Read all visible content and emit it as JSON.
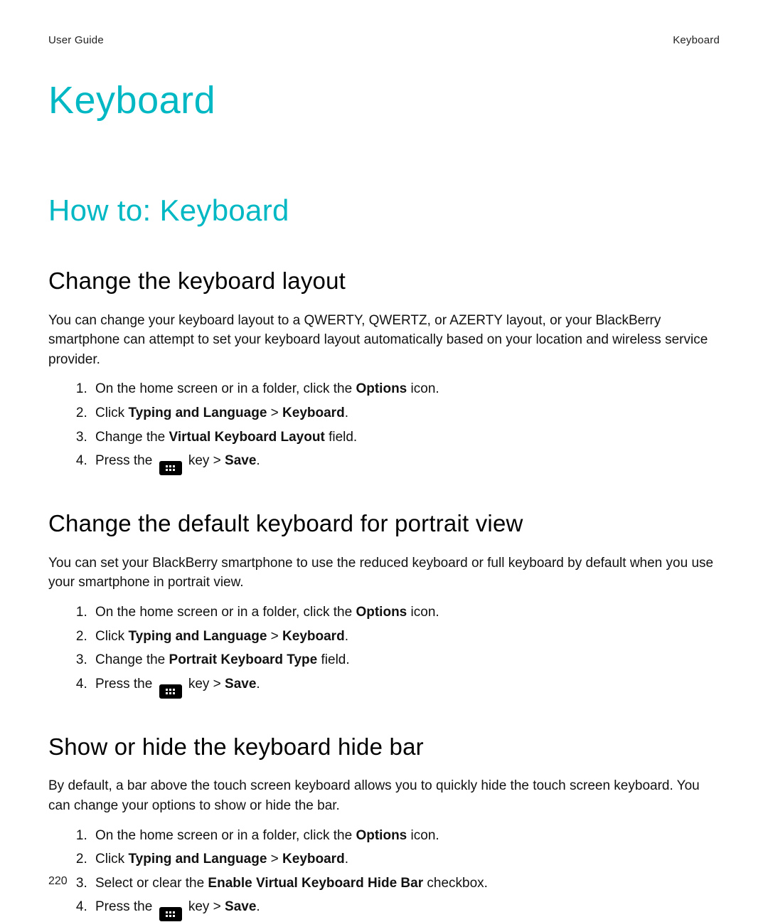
{
  "runhead": {
    "left": "User Guide",
    "right": "Keyboard"
  },
  "chapter_title": "Keyboard",
  "section_title": "How to: Keyboard",
  "groups": [
    {
      "heading": "Change the keyboard layout",
      "intro": "You can change your keyboard layout to a QWERTY, QWERTZ, or AZERTY layout, or your BlackBerry smartphone can attempt to set your keyboard layout automatically based on your location and wireless service provider.",
      "steps": [
        {
          "type": "textbold",
          "pre": "On the home screen or in a folder, click the ",
          "bold": "Options",
          "post": " icon."
        },
        {
          "type": "path",
          "prefix": "Click ",
          "a": "Typing and Language",
          "sep": " > ",
          "b": "Keyboard",
          "suffix": "."
        },
        {
          "type": "textbold",
          "pre": "Change the ",
          "bold": "Virtual Keyboard Layout",
          "post": " field."
        },
        {
          "type": "press_save",
          "pre": "Press the ",
          "mid": " key > ",
          "bold": "Save",
          "post": "."
        }
      ]
    },
    {
      "heading": "Change the default keyboard for portrait view",
      "intro": "You can set your BlackBerry smartphone to use the reduced keyboard or full keyboard by default when you use your smartphone in portrait view.",
      "steps": [
        {
          "type": "textbold",
          "pre": "On the home screen or in a folder, click the ",
          "bold": "Options",
          "post": " icon."
        },
        {
          "type": "path",
          "prefix": "Click ",
          "a": "Typing and Language",
          "sep": " > ",
          "b": "Keyboard",
          "suffix": "."
        },
        {
          "type": "textbold",
          "pre": "Change the ",
          "bold": "Portrait Keyboard Type",
          "post": " field."
        },
        {
          "type": "press_save",
          "pre": "Press the ",
          "mid": " key > ",
          "bold": "Save",
          "post": "."
        }
      ]
    },
    {
      "heading": "Show or hide the keyboard hide bar",
      "intro": "By default, a bar above the touch screen keyboard allows you to quickly hide the touch screen keyboard. You can change your options to show or hide the bar.",
      "steps": [
        {
          "type": "textbold",
          "pre": "On the home screen or in a folder, click the ",
          "bold": "Options",
          "post": " icon."
        },
        {
          "type": "path",
          "prefix": "Click ",
          "a": "Typing and Language",
          "sep": " > ",
          "b": "Keyboard",
          "suffix": "."
        },
        {
          "type": "textbold",
          "pre": "Select or clear the ",
          "bold": "Enable Virtual Keyboard Hide Bar",
          "post": " checkbox."
        },
        {
          "type": "press_save",
          "pre": "Press the ",
          "mid": " key > ",
          "bold": "Save",
          "post": "."
        }
      ]
    }
  ],
  "page_number": "220"
}
